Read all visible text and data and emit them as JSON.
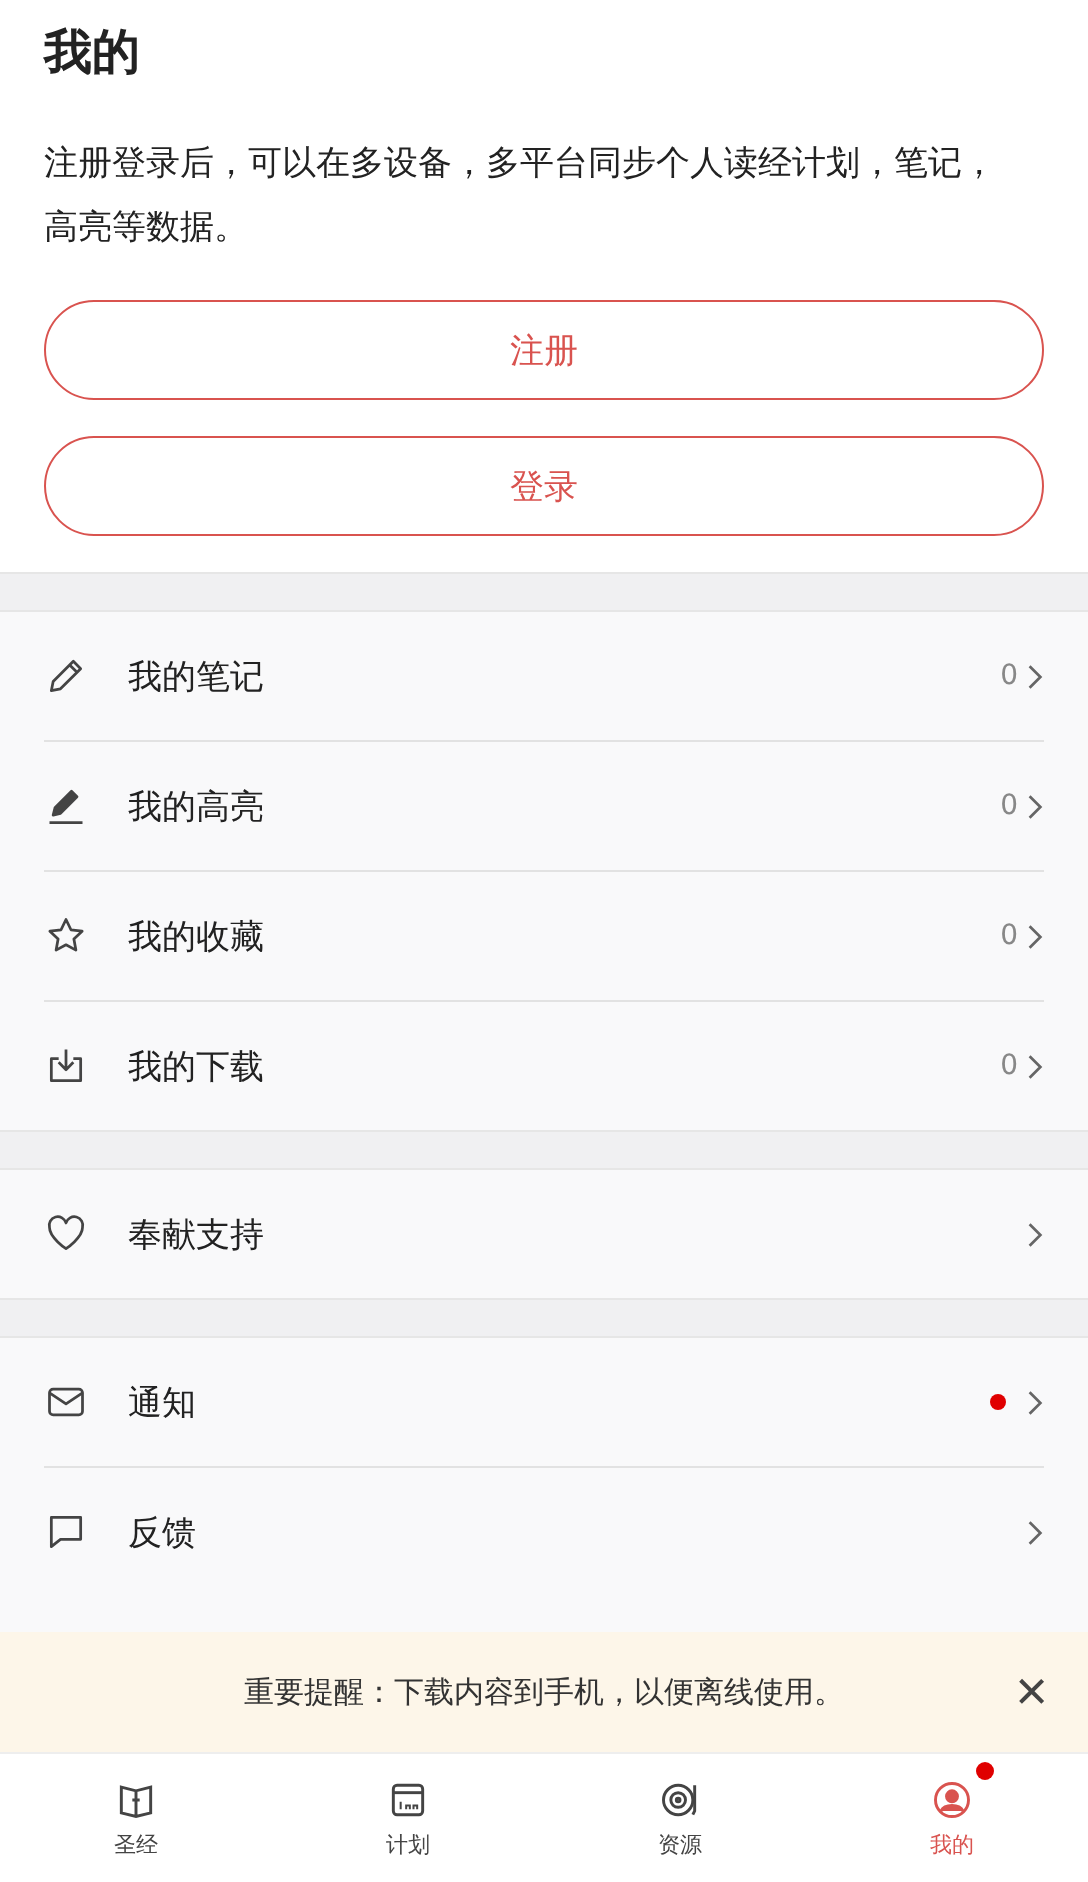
{
  "title": "我的",
  "intro": "注册登录后，可以在多设备，多平台同步个人读经计划，笔记，高亮等数据。",
  "buttons": [
    "注册",
    "登录"
  ],
  "groups": [
    [
      {
        "label": "我的笔记",
        "count": "0",
        "dot": false
      },
      {
        "label": "我的高亮",
        "count": "0",
        "dot": false
      },
      {
        "label": "我的收藏",
        "count": "0",
        "dot": false
      },
      {
        "label": "我的下载",
        "count": "0",
        "dot": false
      }
    ],
    [
      {
        "label": "奉献支持",
        "dot": false
      }
    ],
    [
      {
        "label": "通知",
        "dot": true
      },
      {
        "label": "反馈",
        "dot": false
      }
    ]
  ],
  "banner": {
    "text": "重要提醒：下载内容到手机，以便离线使用。",
    "close": "×"
  },
  "tabs": [
    {
      "label": "圣经",
      "selected": false,
      "dot": false
    },
    {
      "label": "计划",
      "selected": false,
      "dot": false
    },
    {
      "label": "资源",
      "selected": false,
      "dot": false
    },
    {
      "label": "我的",
      "selected": true,
      "dot": true
    }
  ]
}
